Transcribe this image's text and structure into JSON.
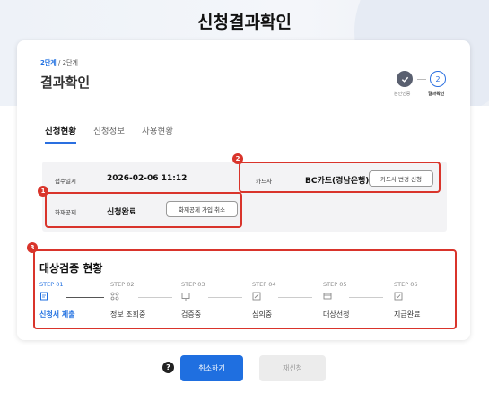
{
  "page": {
    "title": "신청결과확인"
  },
  "card": {
    "step_current": "2단계",
    "step_total": " / 2단계",
    "title": "결과확인",
    "progress": {
      "step1_label": "본인인증",
      "step2_number": "2",
      "step2_label": "결과확인"
    }
  },
  "tabs": [
    {
      "label": "신청현황",
      "active": true
    },
    {
      "label": "신청정보",
      "active": false
    },
    {
      "label": "사용현황",
      "active": false
    }
  ],
  "info": {
    "received_label": "접수일시",
    "received_value": "2026-02-06 11:12",
    "insurance_label": "화재공제",
    "insurance_value": "신청완료",
    "insurance_button": "화재공제 가입 취소",
    "card_label": "카드사",
    "card_value": "BC카드(경남은행)",
    "card_button": "카드사 변경 신청"
  },
  "badges": [
    "1",
    "2",
    "3"
  ],
  "verification": {
    "title": "대상검증 현황",
    "steps": [
      {
        "code": "STEP 01",
        "name": "신청서 제출",
        "icon": "document-icon",
        "active": true
      },
      {
        "code": "STEP 02",
        "name": "정보 조회중",
        "icon": "nodes-icon",
        "active": false
      },
      {
        "code": "STEP 03",
        "name": "검증중",
        "icon": "screen-check-icon",
        "active": false
      },
      {
        "code": "STEP 04",
        "name": "심의중",
        "icon": "edit-icon",
        "active": false
      },
      {
        "code": "STEP 05",
        "name": "대상선정",
        "icon": "card-icon",
        "active": false
      },
      {
        "code": "STEP 06",
        "name": "지급완료",
        "icon": "checkbox-icon",
        "active": false
      }
    ]
  },
  "footer": {
    "help_icon": "?",
    "cancel_button": "취소하기",
    "reapply_button": "재신청"
  },
  "colors": {
    "accent": "#1f6fe0",
    "highlight": "#d9342b"
  }
}
